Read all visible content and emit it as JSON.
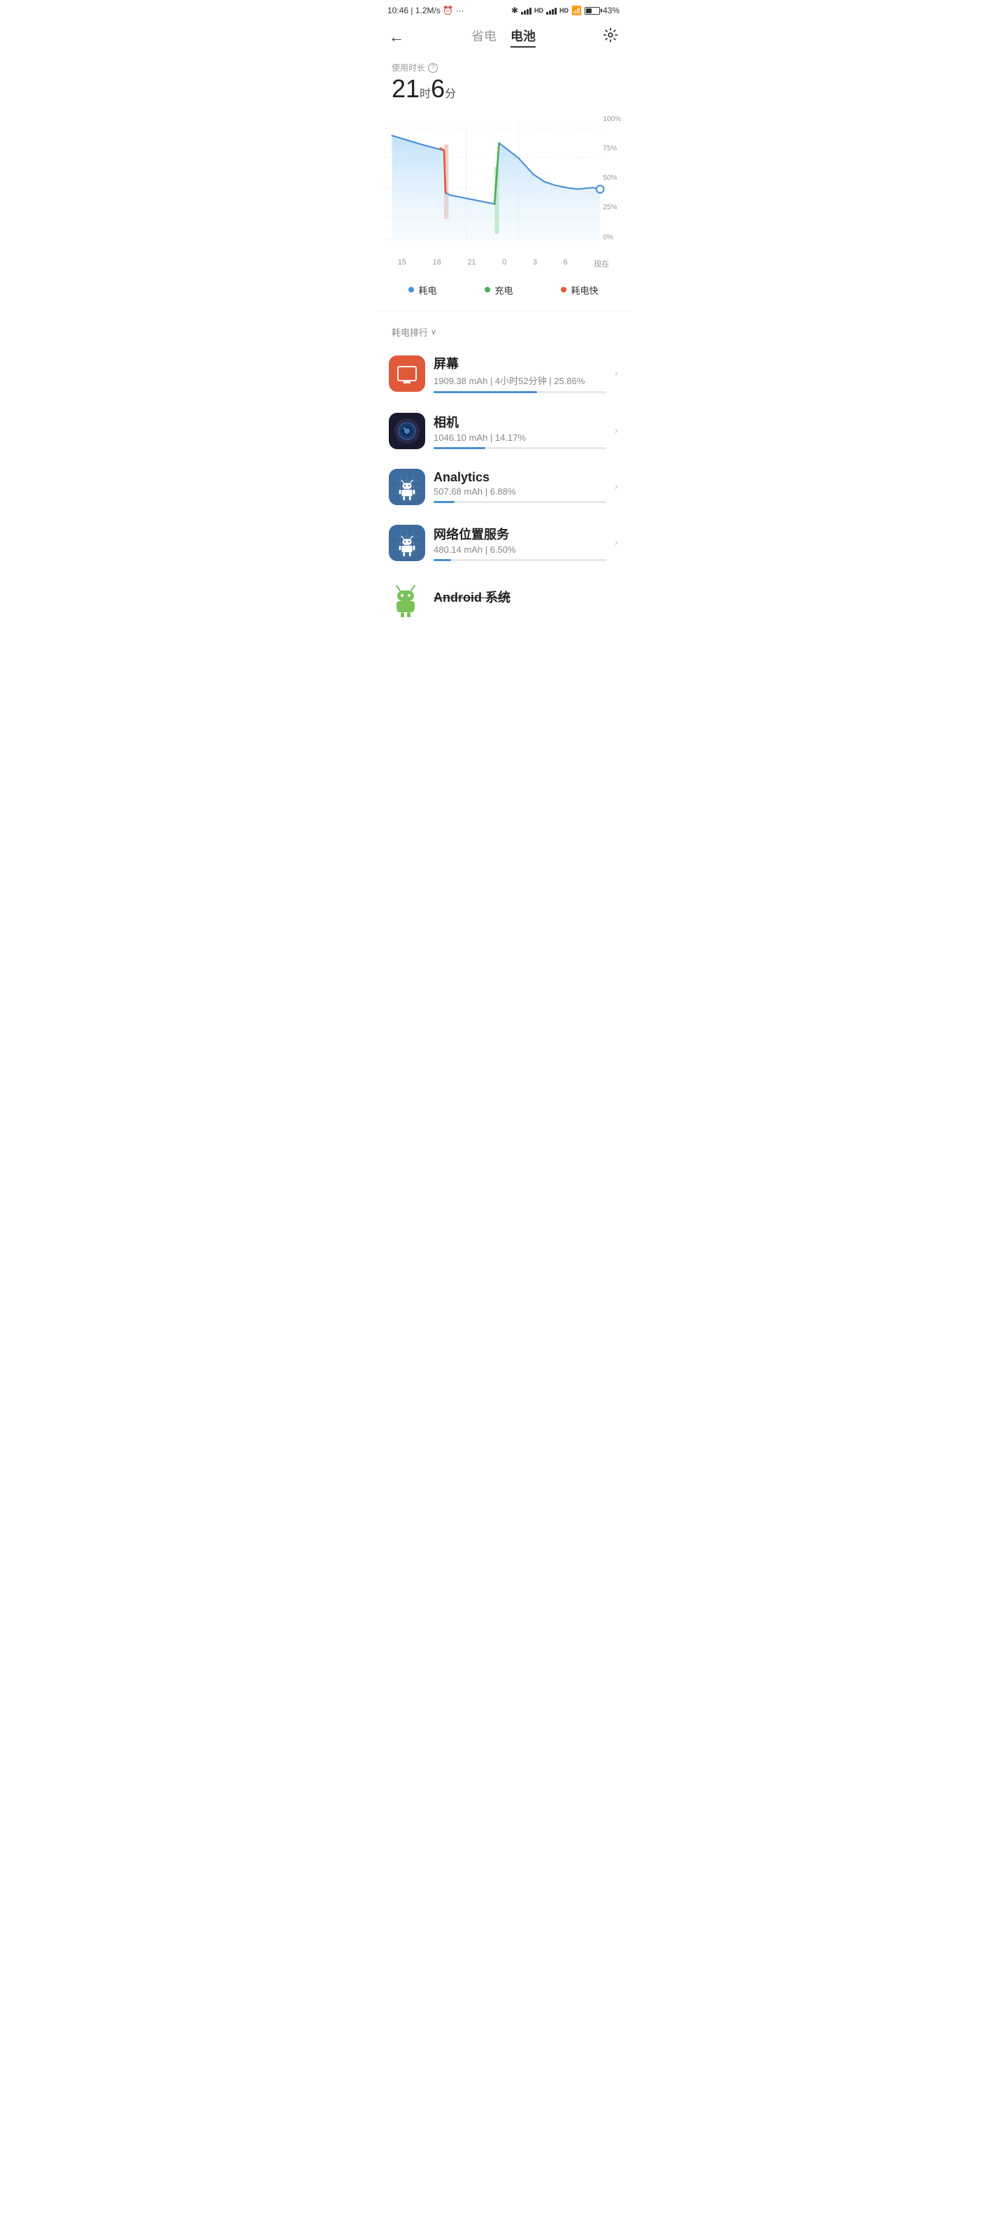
{
  "statusBar": {
    "time": "10:46",
    "network": "1.2M/s",
    "battery": "43%"
  },
  "header": {
    "backLabel": "←",
    "tab1": "省电",
    "tab2": "电池",
    "activeTab": "tab2"
  },
  "usageSection": {
    "label": "使用时长",
    "hours": "21",
    "hoursUnit": "时",
    "minutes": "6",
    "minutesUnit": "分"
  },
  "chart": {
    "yLabels": [
      "100%",
      "75%",
      "50%",
      "25%",
      "0%"
    ],
    "xLabels": [
      "15",
      "18",
      "21",
      "0",
      "3",
      "6",
      "现在"
    ]
  },
  "legend": [
    {
      "label": "耗电",
      "color": "#4a90d9"
    },
    {
      "label": "充电",
      "color": "#4caf50"
    },
    {
      "label": "耗电快",
      "color": "#e05a3a"
    }
  ],
  "rankingHeader": "耗电排行",
  "apps": [
    {
      "name": "屏幕",
      "stats": "1909.38 mAh | 4小时52分钟 | 25.86%",
      "progress": 60,
      "iconType": "screen"
    },
    {
      "name": "相机",
      "stats": "1046.10 mAh | 14.17%",
      "progress": 30,
      "iconType": "camera"
    },
    {
      "name": "Analytics",
      "stats": "507.68 mAh | 6.88%",
      "progress": 12,
      "iconType": "android-grid"
    },
    {
      "name": "网络位置服务",
      "stats": "480.14 mAh | 6.50%",
      "progress": 10,
      "iconType": "android-grid"
    },
    {
      "name": "Android 系统",
      "stats": "",
      "progress": 0,
      "iconType": "android-logo"
    }
  ],
  "chevron": "›"
}
